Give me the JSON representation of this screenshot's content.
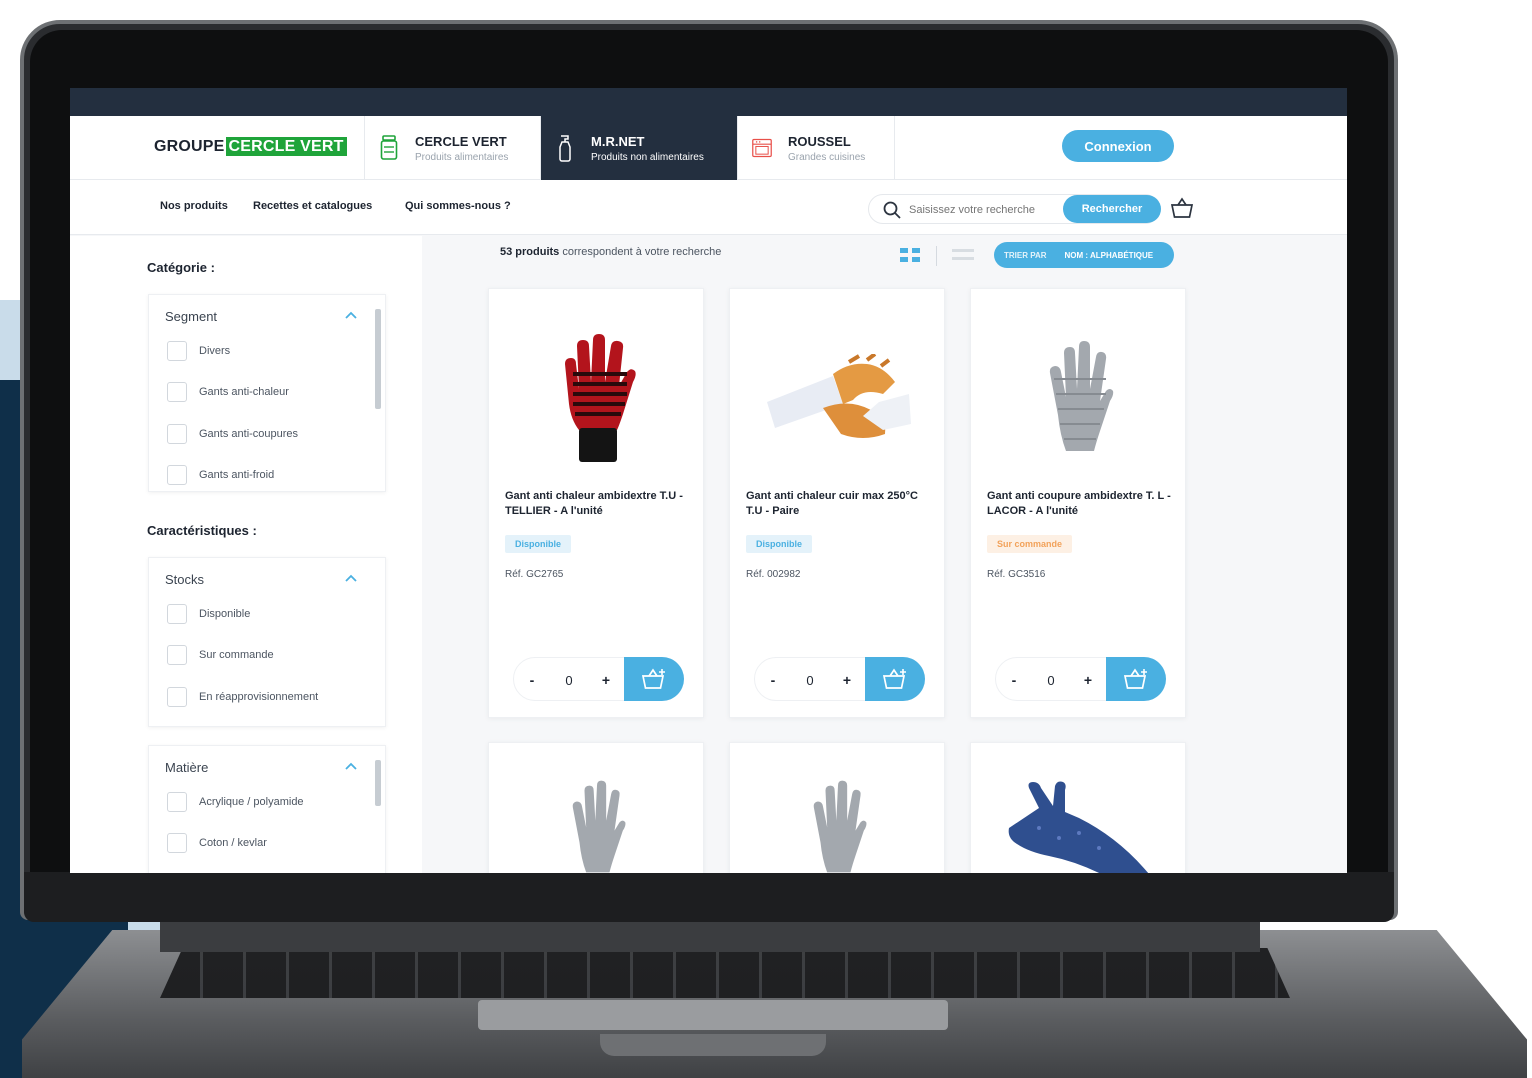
{
  "header": {
    "logo_text": "GROUPE",
    "logo_highlight": "CERCLE VERT",
    "brands": [
      {
        "name": "CERCLE VERT",
        "subtitle": "Produits alimentaires",
        "icon": "jar-icon"
      },
      {
        "name": "M.R.NET",
        "subtitle": "Produits non alimentaires",
        "icon": "spray-bottle-icon",
        "active": true
      },
      {
        "name": "ROUSSEL",
        "subtitle": "Grandes cuisines",
        "icon": "oven-icon"
      }
    ],
    "login_label": "Connexion"
  },
  "nav": {
    "links": [
      "Nos produits",
      "Recettes et catalogues",
      "Qui sommes-nous ?"
    ],
    "search_placeholder": "Saisissez votre recherche",
    "search_button": "Rechercher"
  },
  "sidebar": {
    "category_title": "Catégorie :",
    "characteristics_title": "Caractéristiques :",
    "filters": [
      {
        "title": "Segment",
        "options": [
          "Divers",
          "Gants anti-chaleur",
          "Gants anti-coupures",
          "Gants anti-froid"
        ]
      },
      {
        "title": "Stocks",
        "options": [
          "Disponible",
          "Sur commande",
          "En réapprovisionnement"
        ]
      },
      {
        "title": "Matière",
        "options": [
          "Acrylique / polyamide",
          "Coton / kevlar"
        ]
      }
    ]
  },
  "results": {
    "count": "53 produits",
    "count_suffix": "correspondent à votre recherche",
    "sort_label": "TRIER PAR",
    "sort_value": "NOM : ALPHABÉTIQUE"
  },
  "products": [
    {
      "name": "Gant anti chaleur ambidextre T.U - TELLIER - A l'unité",
      "status": "Disponible",
      "status_type": "ok",
      "ref": "Réf. GC2765",
      "qty": "0"
    },
    {
      "name": "Gant anti chaleur cuir max 250°C T.U - Paire",
      "status": "Disponible",
      "status_type": "ok",
      "ref": "Réf. 002982",
      "qty": "0"
    },
    {
      "name": "Gant anti coupure ambidextre T. L - LACOR - A l'unité",
      "status": "Sur commande",
      "status_type": "order",
      "ref": "Réf. GC3516",
      "qty": "0"
    }
  ],
  "colors": {
    "accent": "#4ab0e1",
    "dark": "#232f3f",
    "brand_green": "#1fa43a",
    "order": "#f2a25a"
  }
}
